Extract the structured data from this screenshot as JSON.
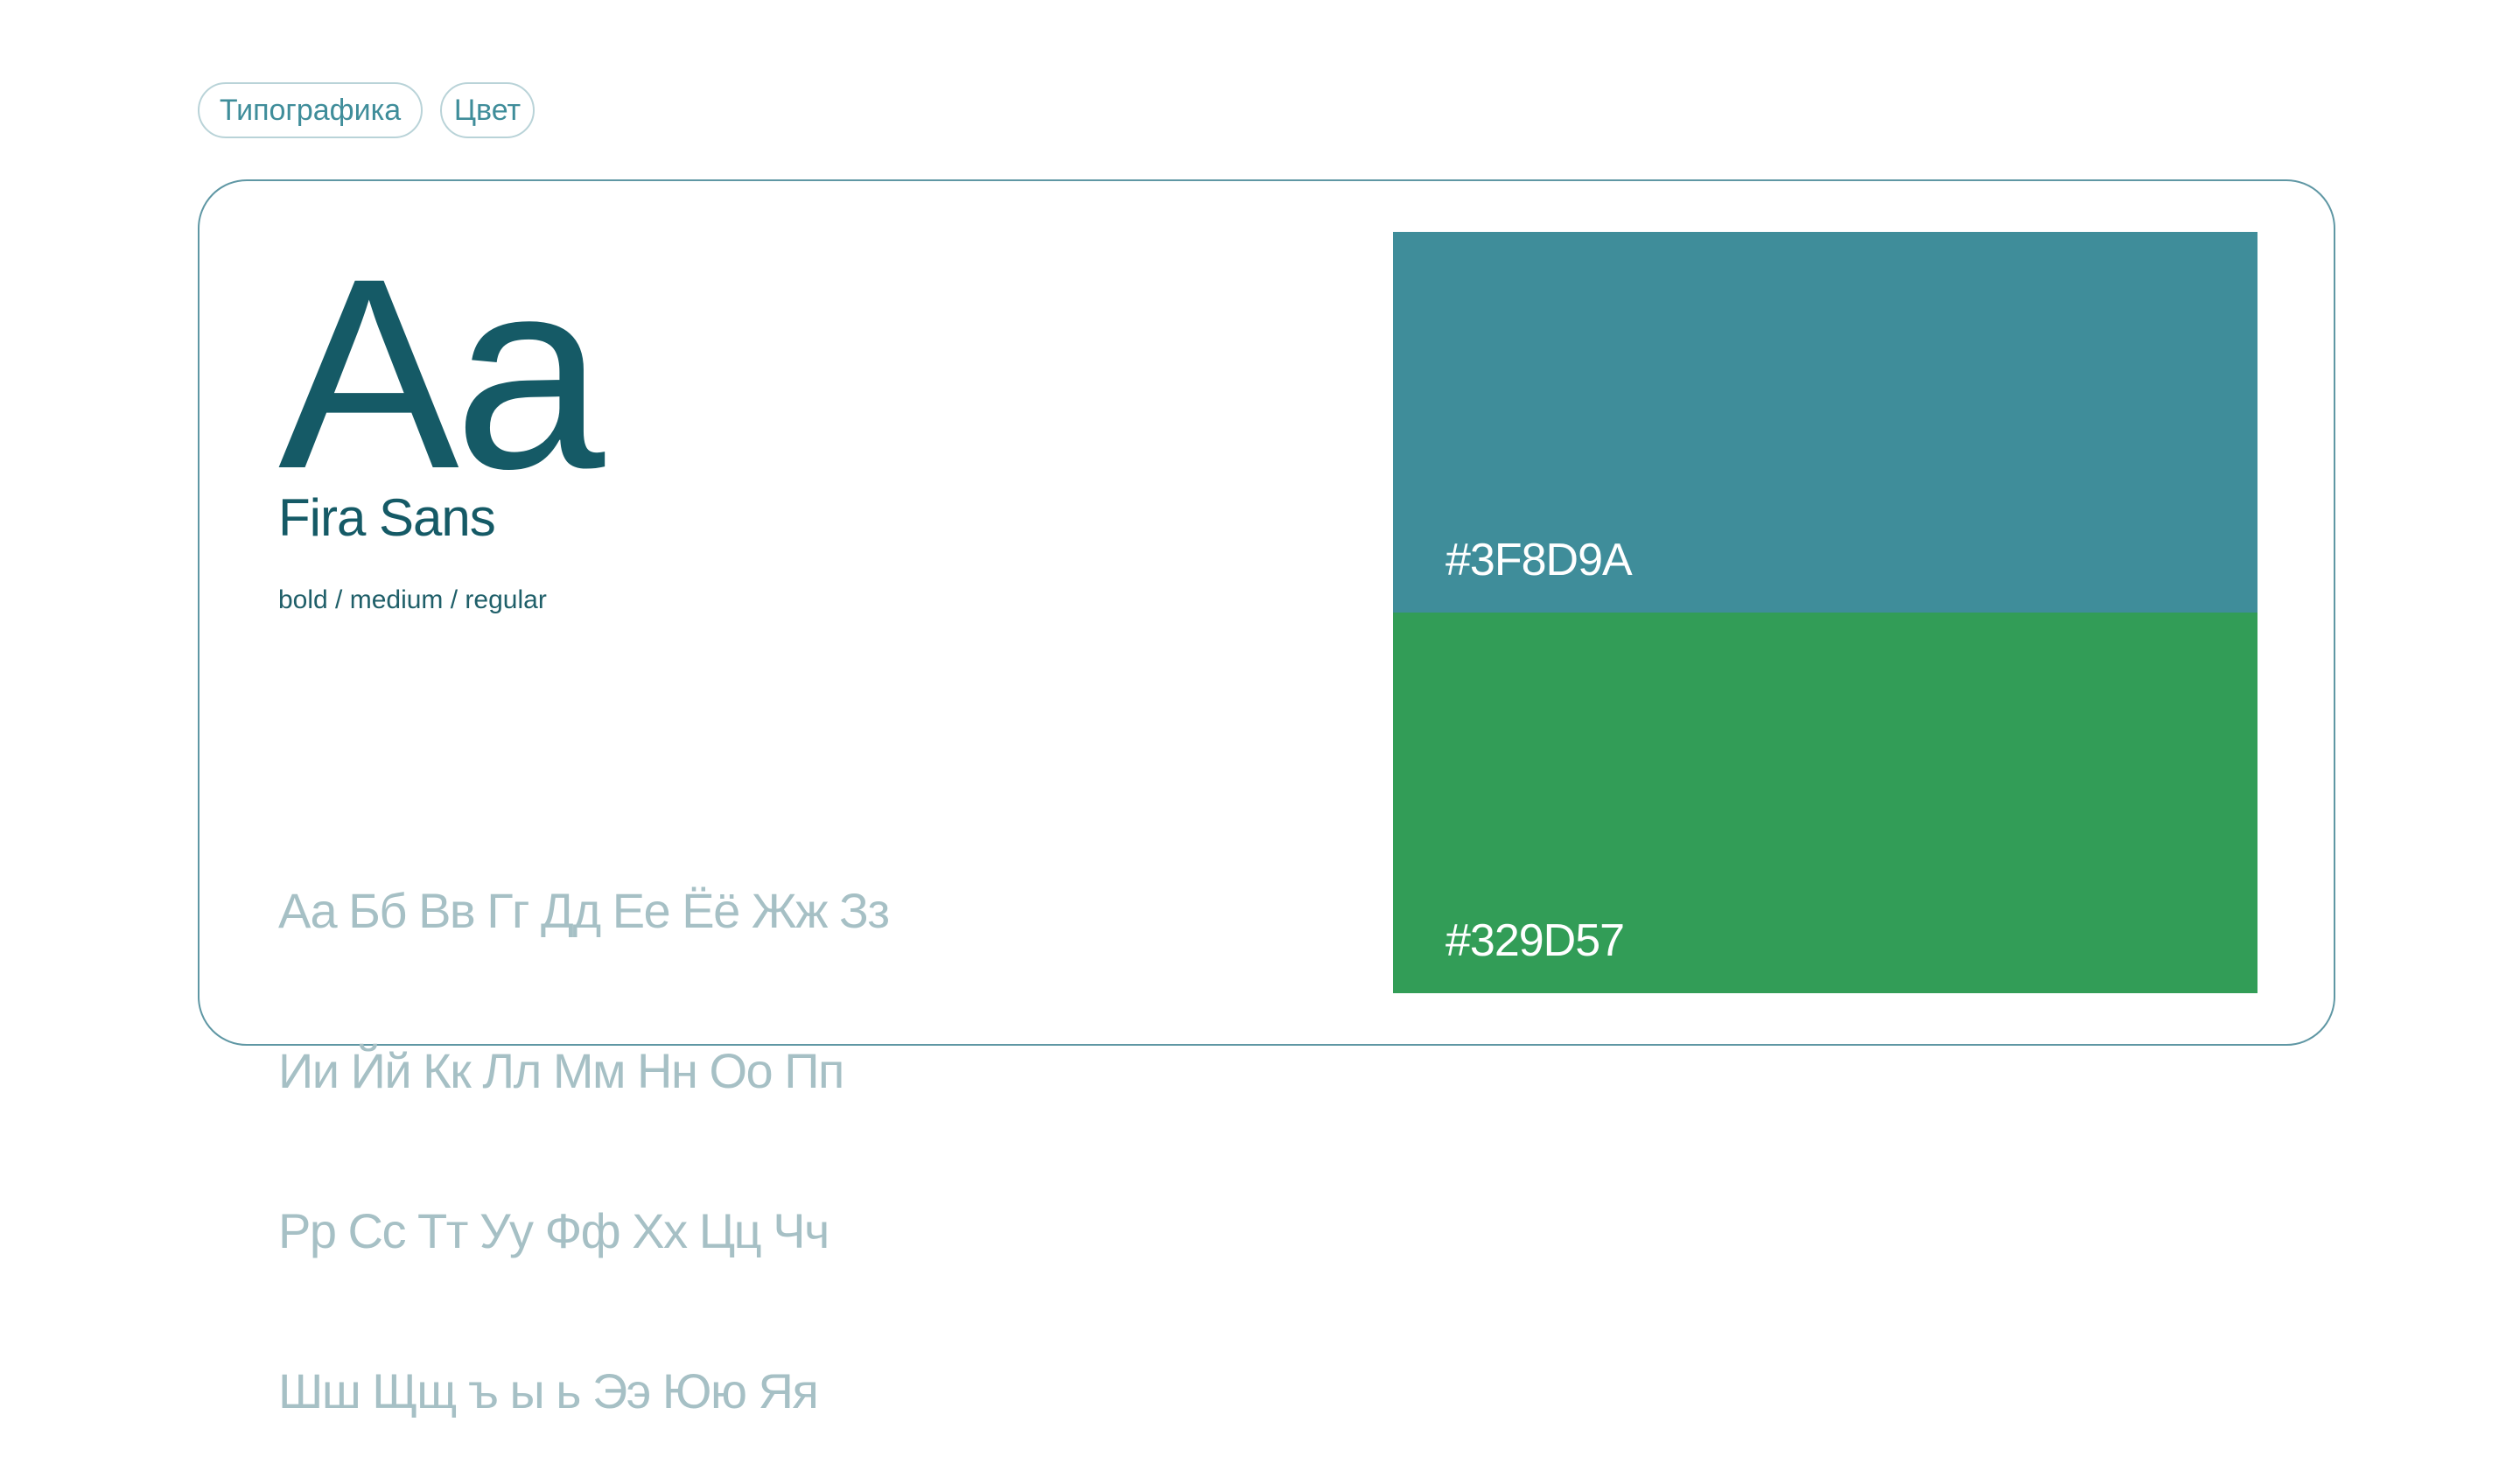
{
  "tabs": [
    {
      "label": "Типографика"
    },
    {
      "label": "Цвет"
    }
  ],
  "typography": {
    "sample": "Aa",
    "font_name": "Fira Sans",
    "weights": "bold / medium / regular",
    "alphabet_lines": [
      "Аа Бб Вв Гг Дд Ее Ёё Жж Зз",
      "Ии Йй Кк Лл Мм Нн Оо Пп",
      "Рр Сс Тт Уу Фф Хх Цц Чч",
      "Шш Щщ ъ ы ь Ээ Юю Яя"
    ]
  },
  "colors": [
    {
      "hex": "#3F8D9A",
      "value": "#3f8d9a"
    },
    {
      "hex": "#329D57",
      "value": "#329d57"
    }
  ]
}
